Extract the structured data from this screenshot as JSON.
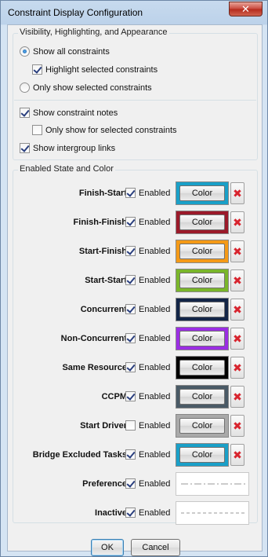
{
  "window": {
    "title": "Constraint Display Configuration",
    "close_glyph": "✕"
  },
  "visibility": {
    "legend": "Visibility, Highlighting, and Appearance",
    "show_all": {
      "label": "Show all constraints",
      "selected": true
    },
    "highlight_selected": {
      "label": "Highlight selected constraints",
      "checked": true
    },
    "only_selected": {
      "label": "Only show selected constraints",
      "selected": false
    },
    "show_notes": {
      "label": "Show constraint notes",
      "checked": true
    },
    "notes_only_selected": {
      "label": "Only show for selected constraints",
      "checked": false
    },
    "intergroup_links": {
      "label": "Show intergroup links",
      "checked": true
    }
  },
  "state": {
    "legend": "Enabled State and Color",
    "enabled_label": "Enabled",
    "color_button_label": "Color",
    "delete_glyph": "✖",
    "rows": [
      {
        "label": "Finish-Start",
        "enabled": true,
        "color": "#1aa0c8"
      },
      {
        "label": "Finish-Finish",
        "enabled": true,
        "color": "#9b1a2a"
      },
      {
        "label": "Start-Finish",
        "enabled": true,
        "color": "#f59a16"
      },
      {
        "label": "Start-Start",
        "enabled": true,
        "color": "#7ab62a"
      },
      {
        "label": "Concurrent",
        "enabled": true,
        "color": "#132547"
      },
      {
        "label": "Non-Concurrent",
        "enabled": true,
        "color": "#9b2ee3"
      },
      {
        "label": "Same Resource",
        "enabled": true,
        "color": "#000000"
      },
      {
        "label": "CCPM",
        "enabled": true,
        "color": "#4a5a66"
      },
      {
        "label": "Start Driver",
        "enabled": false,
        "color": "#a9a9a9"
      },
      {
        "label": "Bridge Excluded Tasks",
        "enabled": true,
        "color": "#1aa0c8"
      },
      {
        "label": "Preference",
        "enabled": true,
        "line_style": "dash-dot"
      },
      {
        "label": "Inactive",
        "enabled": true,
        "line_style": "dashed"
      }
    ]
  },
  "buttons": {
    "ok": "OK",
    "cancel": "Cancel"
  }
}
